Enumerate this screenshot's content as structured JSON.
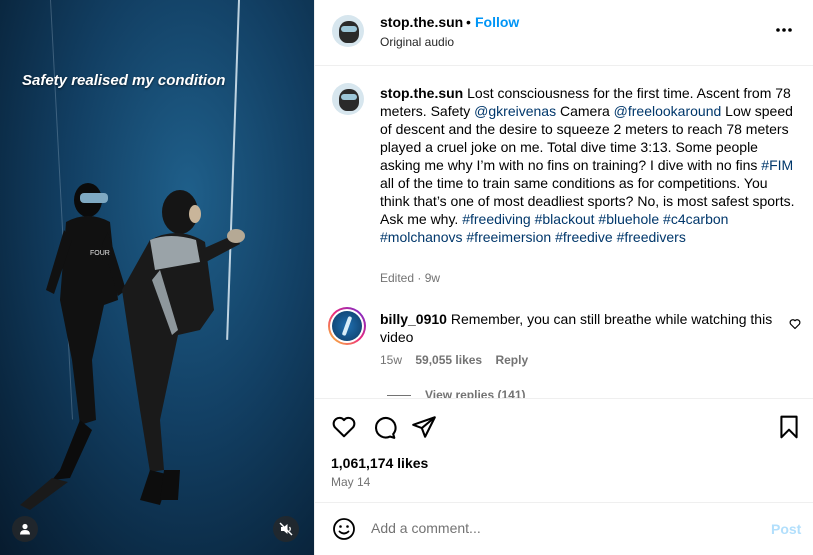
{
  "video": {
    "overlay_text": "Safety realised my condition",
    "user_icon": "user-icon",
    "mute_icon": "speaker-muted-icon"
  },
  "header": {
    "username": "stop.the.sun",
    "separator": "•",
    "follow_label": "Follow",
    "audio": "Original audio",
    "more_icon": "more-horizontal-icon"
  },
  "post": {
    "username": "stop.the.sun",
    "text_1": " Lost consciousness for the first time. Ascent from 78 meters. Safety ",
    "tag_1": "@gkreivenas",
    "text_2": " Camera ",
    "tag_2": "@freelookaround",
    "text_3": " Low speed of descent and the desire to squeeze 2 meters to reach 78 meters played a cruel joke on me. Total dive time 3:13. Some people asking me why I’m with no fins on training? I dive with no fins ",
    "tag_3": "#FIM",
    "text_4": " all of the time to train same conditions as for competitions. You think that’s one of most deadliest sports? No, is most safest sports. Ask me why. ",
    "tag_4": "#freediving",
    "tag_5": "#blackout",
    "tag_6": "#bluehole",
    "tag_7": "#c4carbon",
    "tag_8": "#molchanovs",
    "tag_9": "#freeimersion",
    "tag_10": "#freedive",
    "tag_11": "#freedivers",
    "edited": "Edited · 9w"
  },
  "comment": {
    "username": "billy_0910",
    "text": " Remember, you can still breathe while watching this video",
    "age": "15w",
    "likes": "59,055 likes",
    "reply_label": "Reply",
    "view_replies": "View replies (141)"
  },
  "actions": {
    "likes": "1,061,174 likes",
    "date": "May 14"
  },
  "add_comment": {
    "placeholder": "Add a comment...",
    "post_label": "Post"
  },
  "colors": {
    "accent": "#0095f6",
    "link": "#00376b",
    "muted": "#737373",
    "post_disabled": "#b2dffc"
  }
}
